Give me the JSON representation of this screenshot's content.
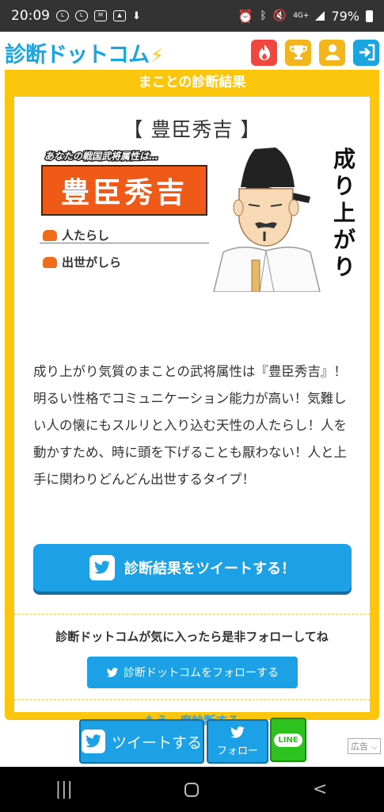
{
  "status_bar": {
    "time": "20:09",
    "notif_icons": [
      "line-icon",
      "line-icon",
      "mail-icon",
      "image-icon",
      "download-icon"
    ],
    "network": "4G+",
    "battery": "79%"
  },
  "header": {
    "logo_text": "診断ドットコム",
    "logo_bolt": "⚡",
    "buttons": [
      {
        "name": "fire-button",
        "icon": "fire-icon",
        "color": "#f0473f"
      },
      {
        "name": "trophy-button",
        "icon": "trophy-icon",
        "color": "#f2b51b"
      },
      {
        "name": "user-button",
        "icon": "user-icon",
        "color": "#f2b51b"
      },
      {
        "name": "login-button",
        "icon": "login-icon",
        "color": "#1aa4e0"
      }
    ]
  },
  "result": {
    "section_title": "まことの診断結果",
    "name_heading": "【 豊臣秀吉 】",
    "illustration": {
      "sub_label": "あなたの戦国武将属性は…",
      "plate_name": "豊臣秀吉",
      "traits": [
        "人たらし",
        "出世がしら"
      ],
      "vertical_text": [
        "成",
        "り",
        "上",
        "が",
        "り"
      ]
    },
    "description": "成り上がり気質のまことの武将属性は『豊臣秀吉』！明るい性格でコミュニケーション能力が高い！気難しい人の懐にもスルリと入り込む天性の人たらし！人を動かすため、時に頭を下げることも厭わない！人と上手に関わりどんどん出世するタイプ！",
    "tweet_button": "診断結果をツイートする！",
    "follow_prompt": "診断ドットコムが気に入ったら是非フォローしてね",
    "follow_button": "診断ドットコムをフォローする",
    "retry_link": "もう一度診断する"
  },
  "bottom_bar": {
    "tweet_label": "ツイートする",
    "follow_label": "フォロー",
    "line_label": "LINE",
    "ad_label": "広告"
  },
  "colors": {
    "accent_yellow": "#fbc60b",
    "twitter_blue": "#1da1e6",
    "line_green": "#2ec21f",
    "plate_orange": "#ef5a18"
  }
}
